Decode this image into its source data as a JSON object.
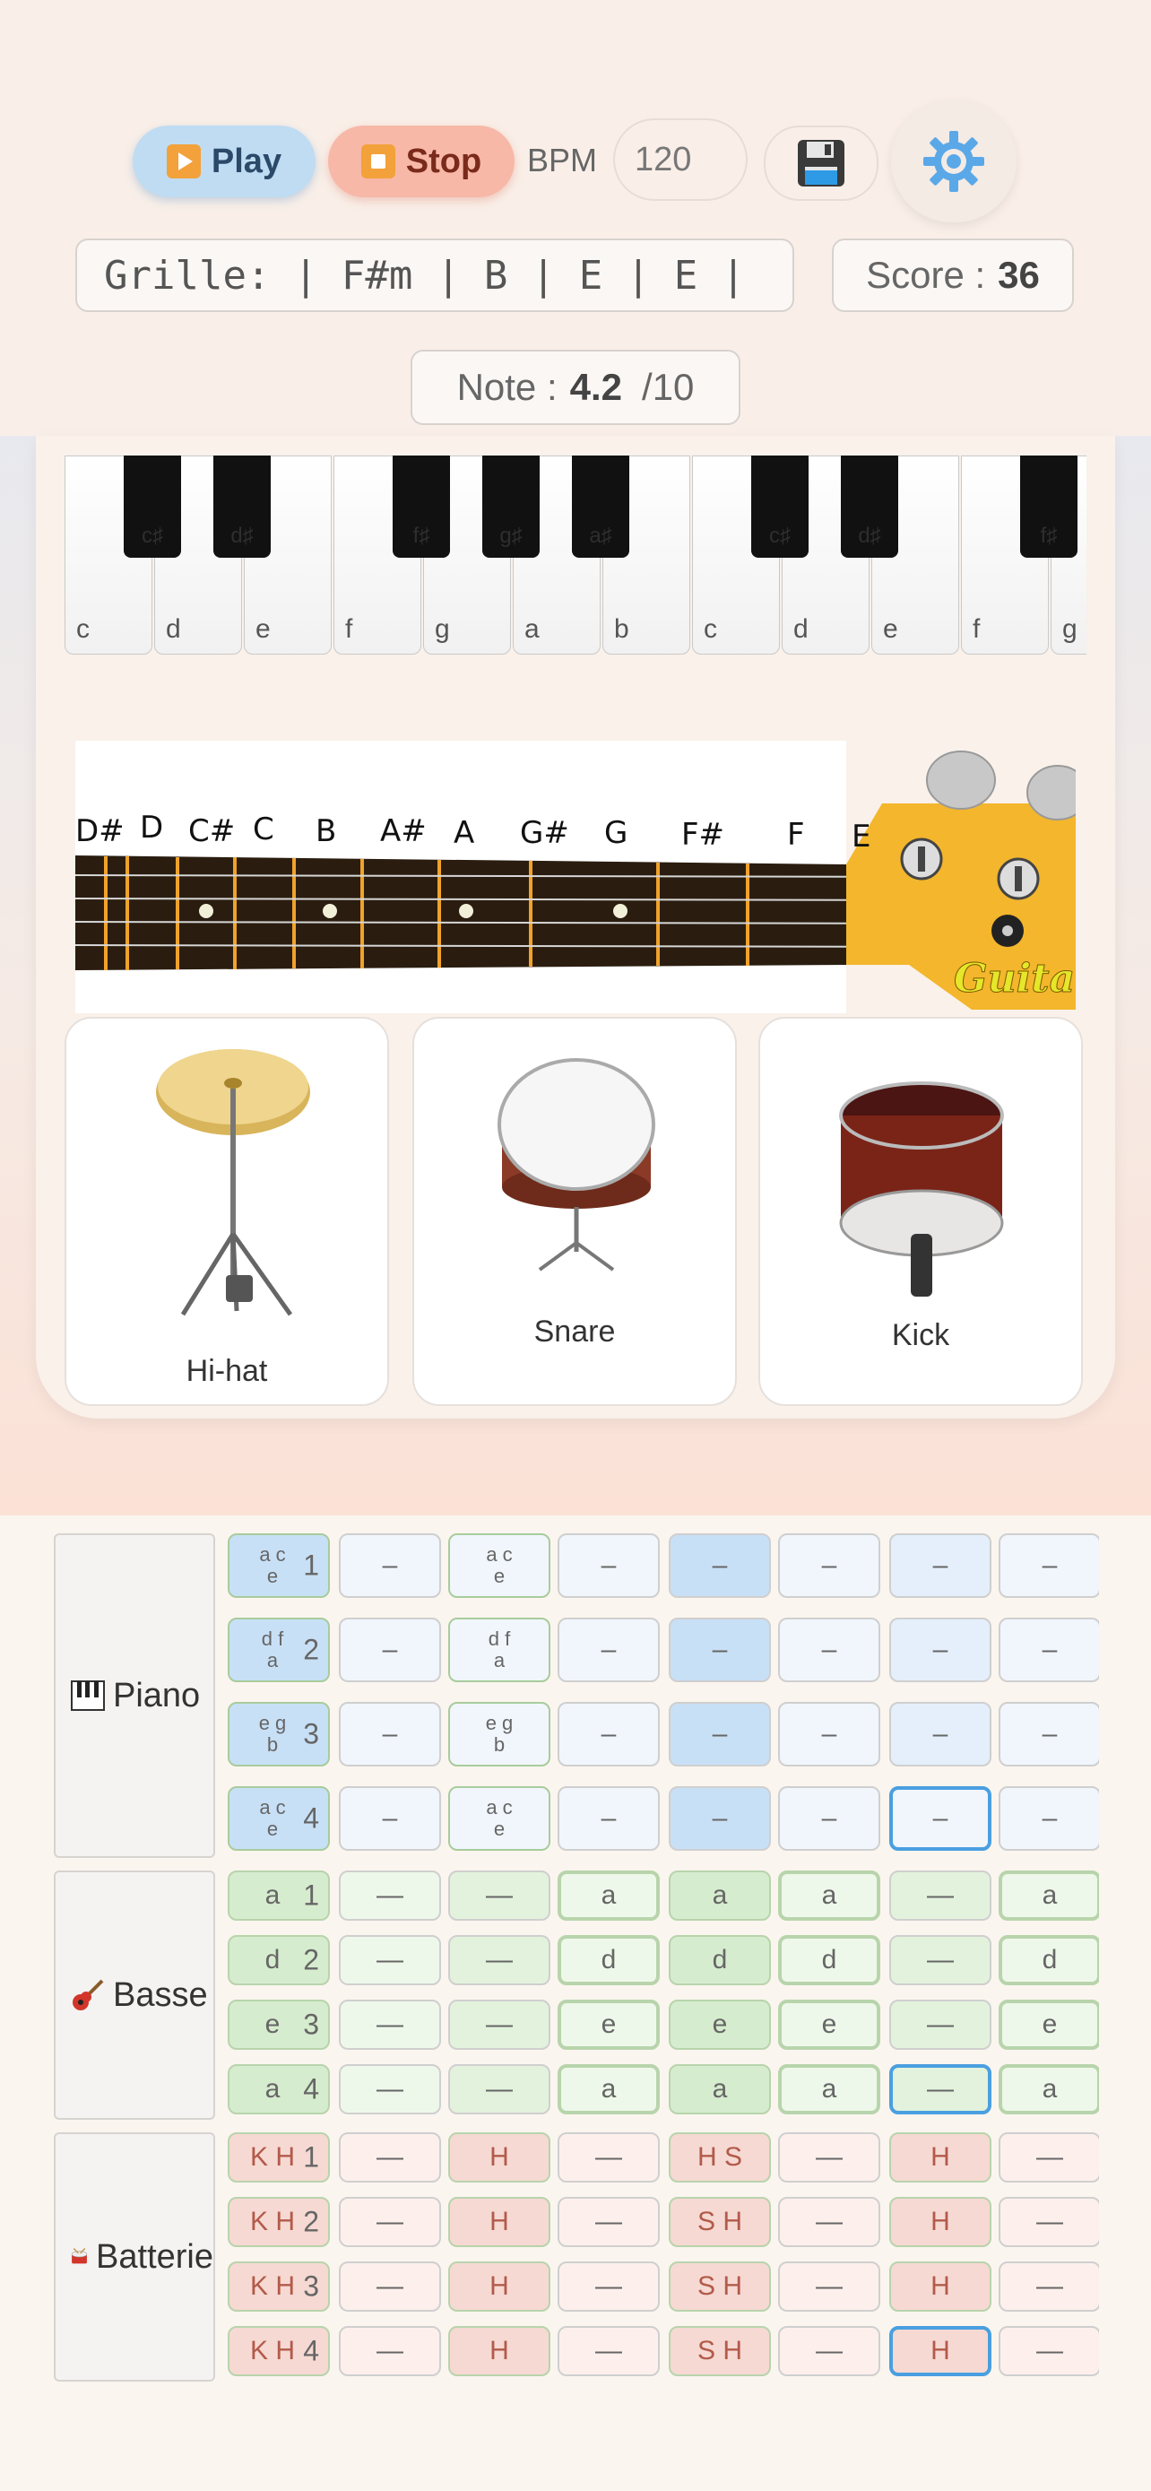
{
  "toolbar": {
    "play_label": "Play",
    "stop_label": "Stop",
    "bpm_label": "BPM",
    "bpm_value": "120"
  },
  "grille": "Grille: | F#m | B | E | E |",
  "score": {
    "label": "Score :",
    "value": "36"
  },
  "note": {
    "label": "Note :",
    "value": "4.2",
    "max": "/10"
  },
  "piano": {
    "white_keys": [
      "c",
      "d",
      "e",
      "f",
      "g",
      "a",
      "b",
      "c",
      "d",
      "e",
      "f",
      "g"
    ],
    "black_keys": [
      "c♯",
      "d♯",
      "f♯",
      "g♯",
      "a♯",
      "c♯",
      "d♯",
      "f♯"
    ]
  },
  "guitar": {
    "fret_labels": [
      "D#",
      "D",
      "C#",
      "C",
      "B",
      "A#",
      "A",
      "G#",
      "G",
      "F#",
      "F",
      "E"
    ],
    "headstock_text": "Guitar"
  },
  "drums": [
    {
      "label": "Hi-hat"
    },
    {
      "label": "Snare"
    },
    {
      "label": "Kick"
    }
  ],
  "sequencer": {
    "tracks": [
      {
        "name": "Piano",
        "icon": "piano-icon",
        "rows": [
          {
            "step": "1",
            "notes": "a c\ne",
            "cells": [
              "–",
              "a c\ne",
              "–",
              "–",
              "–",
              "–",
              "–"
            ]
          },
          {
            "step": "2",
            "notes": "d f\na",
            "cells": [
              "–",
              "d f\na",
              "–",
              "–",
              "–",
              "–",
              "–"
            ]
          },
          {
            "step": "3",
            "notes": "e g\nb",
            "cells": [
              "–",
              "e g\nb",
              "–",
              "–",
              "–",
              "–",
              "–"
            ]
          },
          {
            "step": "4",
            "notes": "a c\ne",
            "cells": [
              "–",
              "a c\ne",
              "–",
              "–",
              "–",
              "–",
              "–"
            ]
          }
        ]
      },
      {
        "name": "Basse",
        "icon": "guitar-icon",
        "rows": [
          {
            "step": "1",
            "notes": "a",
            "cells": [
              "—",
              "—",
              "a",
              "a",
              "a",
              "—",
              "a"
            ]
          },
          {
            "step": "2",
            "notes": "d",
            "cells": [
              "—",
              "—",
              "d",
              "d",
              "d",
              "—",
              "d"
            ]
          },
          {
            "step": "3",
            "notes": "e",
            "cells": [
              "—",
              "—",
              "e",
              "e",
              "e",
              "—",
              "e"
            ]
          },
          {
            "step": "4",
            "notes": "a",
            "cells": [
              "—",
              "—",
              "a",
              "a",
              "a",
              "—",
              "a"
            ]
          }
        ]
      },
      {
        "name": "Batterie",
        "icon": "drum-icon",
        "rows": [
          {
            "step": "1",
            "notes": "K H",
            "cells": [
              "—",
              "H",
              "—",
              "H S",
              "—",
              "H",
              "—"
            ]
          },
          {
            "step": "2",
            "notes": "K H",
            "cells": [
              "—",
              "H",
              "—",
              "S H",
              "—",
              "H",
              "—"
            ]
          },
          {
            "step": "3",
            "notes": "K H",
            "cells": [
              "—",
              "H",
              "—",
              "S H",
              "—",
              "H",
              "—"
            ]
          },
          {
            "step": "4",
            "notes": "K H",
            "cells": [
              "—",
              "H",
              "—",
              "S H",
              "—",
              "H",
              "—"
            ]
          }
        ]
      }
    ]
  },
  "colors": {
    "piano_active": "#c8e0f6",
    "piano_empty": "#f1f6fc",
    "bass_active": "#d6ecce",
    "bass_empty": "#eef8ea",
    "drum_active": "#f6d9d3",
    "drum_empty": "#fdf0ec",
    "cursor_border": "#4a9fe0"
  }
}
